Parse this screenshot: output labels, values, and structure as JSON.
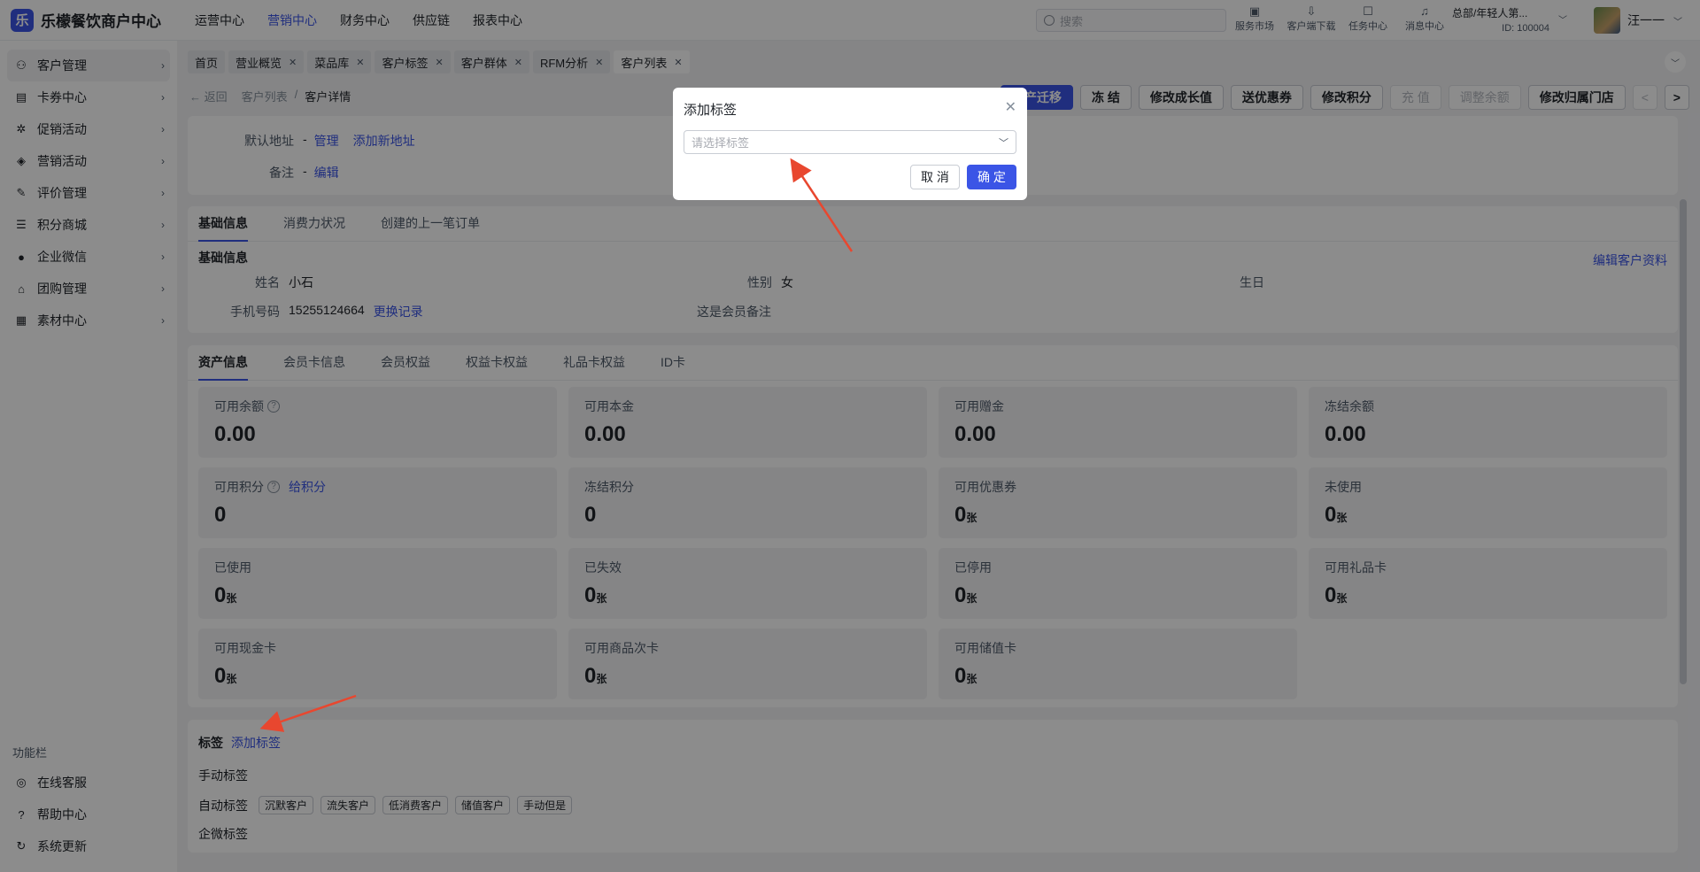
{
  "app": {
    "logo_mark": "乐",
    "name": "乐檬餐饮商户中心"
  },
  "topnav": [
    {
      "label": "运营中心"
    },
    {
      "label": "营销中心"
    },
    {
      "label": "财务中心"
    },
    {
      "label": "供应链"
    },
    {
      "label": "报表中心"
    }
  ],
  "search": {
    "placeholder": "搜索"
  },
  "tools": [
    {
      "label": "服务市场",
      "icon": "shop-icon"
    },
    {
      "label": "客户端下载",
      "icon": "download-icon"
    },
    {
      "label": "任务中心",
      "icon": "task-icon"
    },
    {
      "label": "消息中心",
      "icon": "bell-icon"
    }
  ],
  "org": {
    "name": "总部/年轻人第...",
    "id": "ID: 100004"
  },
  "user": {
    "name": "汪一一"
  },
  "sidebar": {
    "items": [
      {
        "label": "客户管理",
        "icon": "user-icon"
      },
      {
        "label": "卡券中心",
        "icon": "ticket-icon"
      },
      {
        "label": "促销活动",
        "icon": "promo-icon"
      },
      {
        "label": "营销活动",
        "icon": "tag-icon"
      },
      {
        "label": "评价管理",
        "icon": "review-icon"
      },
      {
        "label": "积分商城",
        "icon": "points-icon"
      },
      {
        "label": "企业微信",
        "icon": "wechat-icon"
      },
      {
        "label": "团购管理",
        "icon": "group-icon"
      },
      {
        "label": "素材中心",
        "icon": "image-icon"
      }
    ],
    "func_title": "功能栏",
    "bottom": [
      {
        "label": "在线客服",
        "icon": "support-icon"
      },
      {
        "label": "帮助中心",
        "icon": "help-icon"
      },
      {
        "label": "系统更新",
        "icon": "refresh-icon"
      }
    ]
  },
  "page_tabs": [
    {
      "label": "首页",
      "closable": false
    },
    {
      "label": "营业概览",
      "closable": true
    },
    {
      "label": "菜品库",
      "closable": true
    },
    {
      "label": "客户标签",
      "closable": true
    },
    {
      "label": "客户群体",
      "closable": true
    },
    {
      "label": "RFM分析",
      "closable": true
    },
    {
      "label": "客户列表",
      "closable": true
    }
  ],
  "breadcrumb": {
    "back": "返回",
    "parent": "客户列表",
    "sep": "/",
    "current": "客户详情"
  },
  "actions": [
    {
      "label": "资产迁移",
      "style": "primary"
    },
    {
      "label": "冻 结",
      "style": "normal"
    },
    {
      "label": "修改成长值",
      "style": "normal"
    },
    {
      "label": "送优惠券",
      "style": "normal"
    },
    {
      "label": "修改积分",
      "style": "normal"
    },
    {
      "label": "充 值",
      "style": "disabled"
    },
    {
      "label": "调整余额",
      "style": "disabled"
    },
    {
      "label": "修改归属门店",
      "style": "normal"
    }
  ],
  "nav_prev": "<",
  "nav_next": ">",
  "address": {
    "default_label": "默认地址",
    "default_value": "-",
    "manage": "管理",
    "add": "添加新地址",
    "remark_label": "备注",
    "remark_value": "-",
    "remark_edit": "编辑"
  },
  "basic": {
    "tabs": [
      "基础信息",
      "消费力状况",
      "创建的上一笔订单"
    ],
    "title": "基础信息",
    "edit": "编辑客户资料",
    "name_label": "姓名",
    "name_value": "小石",
    "gender_label": "性别",
    "gender_value": "女",
    "birthday_label": "生日",
    "phone_label": "手机号码",
    "phone_value": "15255124664",
    "phone_history": "更换记录",
    "member_remark": "这是会员备注"
  },
  "assets": {
    "tabs": [
      "资产信息",
      "会员卡信息",
      "会员权益",
      "权益卡权益",
      "礼品卡权益",
      "ID卡"
    ],
    "stats": [
      {
        "label": "可用余额",
        "value": "0.00",
        "help": true
      },
      {
        "label": "可用本金",
        "value": "0.00"
      },
      {
        "label": "可用赠金",
        "value": "0.00"
      },
      {
        "label": "冻结余额",
        "value": "0.00"
      },
      {
        "label": "可用积分",
        "value": "0",
        "help": true,
        "link": "给积分"
      },
      {
        "label": "冻结积分",
        "value": "0"
      },
      {
        "label": "可用优惠券",
        "value": "0",
        "unit": "张"
      },
      {
        "label": "未使用",
        "value": "0",
        "unit": "张"
      },
      {
        "label": "已使用",
        "value": "0",
        "unit": "张"
      },
      {
        "label": "已失效",
        "value": "0",
        "unit": "张"
      },
      {
        "label": "已停用",
        "value": "0",
        "unit": "张"
      },
      {
        "label": "可用礼品卡",
        "value": "0",
        "unit": "张"
      },
      {
        "label": "可用现金卡",
        "value": "0",
        "unit": "张"
      },
      {
        "label": "可用商品次卡",
        "value": "0",
        "unit": "张"
      },
      {
        "label": "可用储值卡",
        "value": "0",
        "unit": "张"
      }
    ]
  },
  "tags": {
    "title": "标签",
    "add": "添加标签",
    "manual_label": "手动标签",
    "auto_label": "自动标签",
    "auto_tags": [
      "沉默客户",
      "流失客户",
      "低消费客户",
      "储值客户",
      "手动但是"
    ],
    "wecom_label": "企微标签"
  },
  "modal": {
    "title": "添加标签",
    "select_placeholder": "请选择标签",
    "cancel": "取 消",
    "ok": "确 定"
  },
  "colors": {
    "accent": "#3b55e6",
    "annotation_arrow": "#e8472f"
  }
}
